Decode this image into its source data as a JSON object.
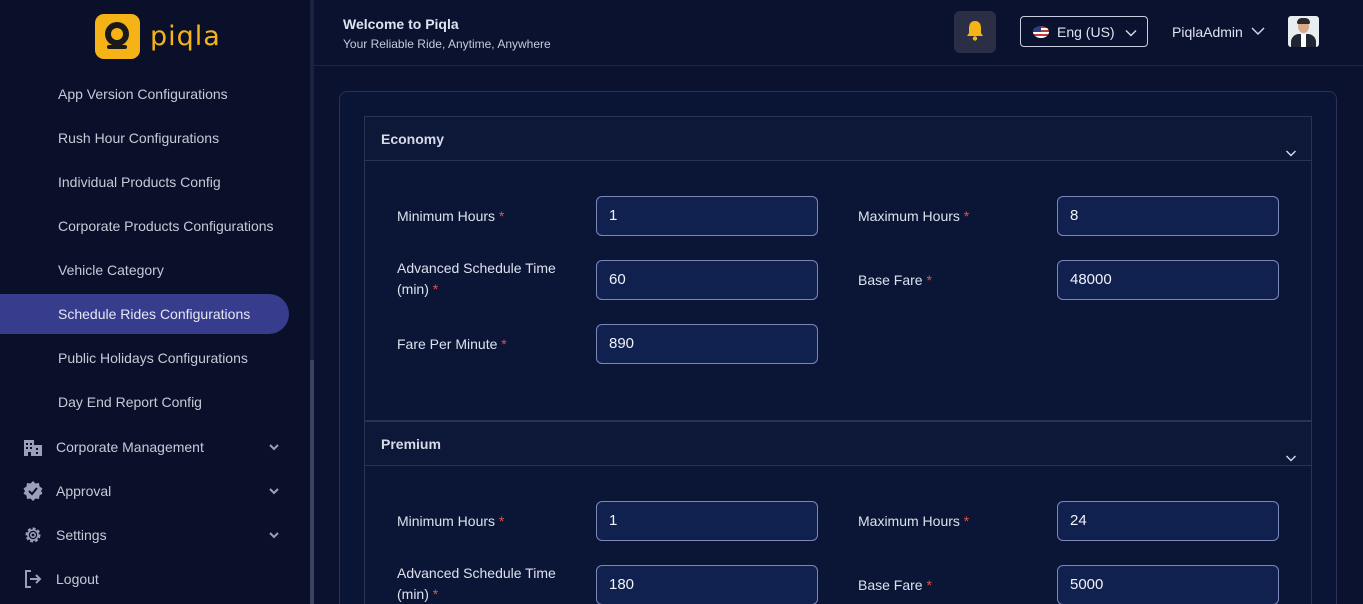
{
  "brand": {
    "name": "piqla"
  },
  "sidebar": {
    "subitems": [
      {
        "label": "App Version Configurations"
      },
      {
        "label": "Rush Hour Configurations"
      },
      {
        "label": "Individual Products Config"
      },
      {
        "label": "Corporate Products Configurations"
      },
      {
        "label": "Vehicle Category"
      },
      {
        "label": "Schedule Rides Configurations",
        "active": true
      },
      {
        "label": "Public Holidays Configurations"
      },
      {
        "label": "Day End Report Config"
      }
    ],
    "main_items": [
      {
        "label": "Corporate Management",
        "icon": "building-icon"
      },
      {
        "label": "Approval",
        "icon": "badge-check-icon"
      },
      {
        "label": "Settings",
        "icon": "gear-icon"
      },
      {
        "label": "Logout",
        "icon": "logout-icon"
      }
    ]
  },
  "header": {
    "title": "Welcome to Piqla",
    "subtitle": "Your Reliable Ride, Anytime, Anywhere",
    "language": "Eng (US)",
    "username": "PiqlaAdmin"
  },
  "sections": [
    {
      "title": "Economy",
      "fields": {
        "min_hours_label": "Minimum Hours",
        "min_hours": "1",
        "max_hours_label": "Maximum Hours",
        "max_hours": "8",
        "adv_label_1": "Advanced Schedule Time",
        "adv_label_2": "(min)",
        "adv_time": "60",
        "base_fare_label": "Base Fare",
        "base_fare": "48000",
        "fare_per_minute_label": "Fare Per Minute",
        "fare_per_minute": "890"
      }
    },
    {
      "title": "Premium",
      "fields": {
        "min_hours_label": "Minimum Hours",
        "min_hours": "1",
        "max_hours_label": "Maximum Hours",
        "max_hours": "24",
        "adv_label_1": "Advanced Schedule Time",
        "adv_label_2": "(min)",
        "adv_time": "180",
        "base_fare_label": "Base Fare",
        "base_fare": "5000"
      }
    }
  ],
  "required_marker": "*",
  "colors": {
    "accent": "#f5b318",
    "active_nav": "#373c8c",
    "required": "#e0524a"
  }
}
